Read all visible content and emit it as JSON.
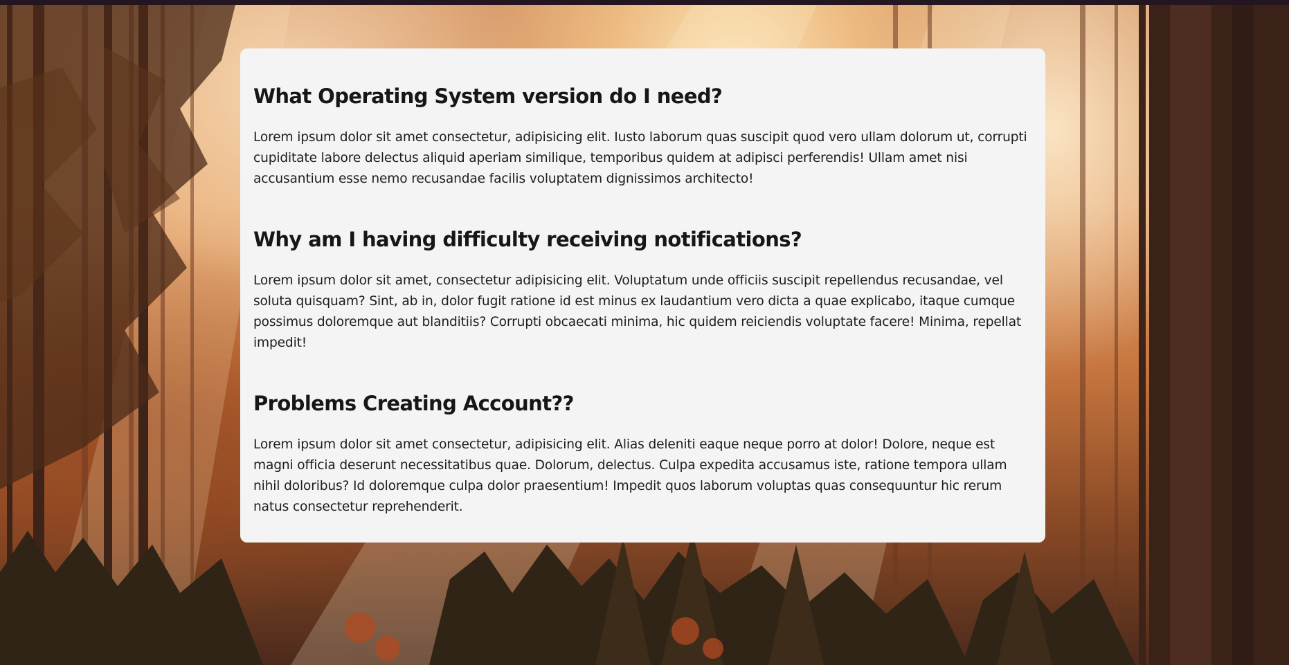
{
  "faq": {
    "items": [
      {
        "question": "What Operating System version do I need?",
        "answer": "Lorem ipsum dolor sit amet consectetur, adipisicing elit. Iusto laborum quas suscipit quod vero ullam dolorum ut, corrupti cupiditate labore delectus aliquid aperiam similique, temporibus quidem at adipisci perferendis! Ullam amet nisi accusantium esse nemo recusandae facilis voluptatem dignissimos architecto!"
      },
      {
        "question": "Why am I having difficulty receiving notifications?",
        "answer": "Lorem ipsum dolor sit amet, consectetur adipisicing elit. Voluptatum unde officiis suscipit repellendus recusandae, vel soluta quisquam? Sint, ab in, dolor fugit ratione id est minus ex laudantium vero dicta a quae explicabo, itaque cumque possimus doloremque aut blanditiis? Corrupti obcaecati minima, hic quidem reiciendis voluptate facere! Minima, repellat impedit!"
      },
      {
        "question": "Problems Creating Account??",
        "answer": "Lorem ipsum dolor sit amet consectetur, adipisicing elit. Alias deleniti eaque neque porro at dolor! Dolore, neque est magni officia deserunt necessitatibus quae. Dolorum, delectus. Culpa expedita accusamus iste, ratione tempora ullam nihil doloribus? Id doloremque culpa dolor praesentium! Impedit quos laborum voluptas quas consequuntur hic rerum natus consectetur reprehenderit."
      }
    ]
  }
}
